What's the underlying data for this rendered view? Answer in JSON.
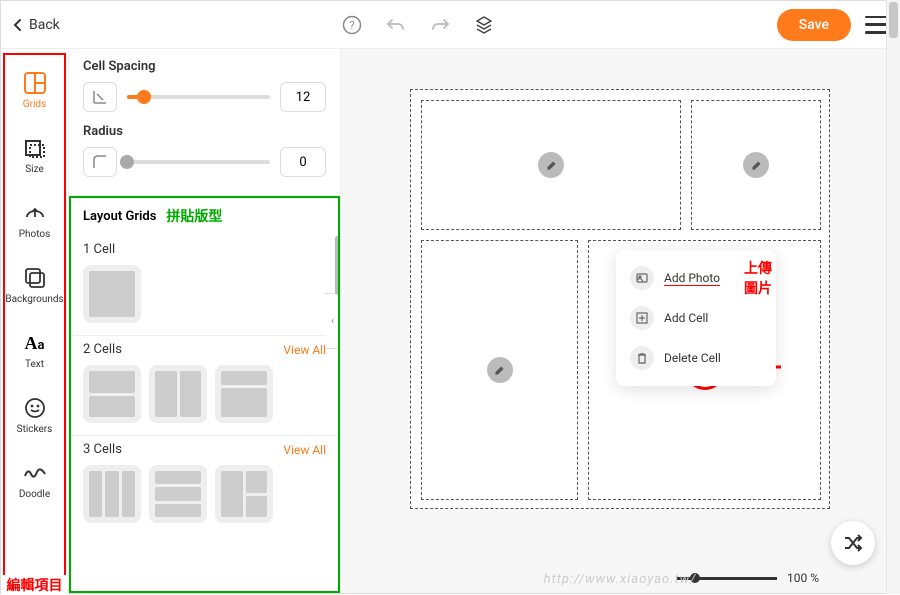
{
  "topbar": {
    "back": "Back",
    "save": "Save"
  },
  "sidebar": {
    "items": [
      {
        "label": "Grids"
      },
      {
        "label": "Size"
      },
      {
        "label": "Photos"
      },
      {
        "label": "Backgrounds"
      },
      {
        "label": "Text"
      },
      {
        "label": "Stickers"
      },
      {
        "label": "Doodle"
      }
    ],
    "annotation": "編輯項目"
  },
  "panel": {
    "cellSpacing": {
      "label": "Cell Spacing",
      "value": "12"
    },
    "radius": {
      "label": "Radius",
      "value": "0"
    },
    "layoutTitle": "Layout Grids",
    "layoutAnnotation": "拼貼版型",
    "sections": [
      {
        "title": "1 Cell"
      },
      {
        "title": "2 Cells",
        "viewAll": "View All"
      },
      {
        "title": "3 Cells",
        "viewAll": "View All"
      }
    ]
  },
  "contextMenu": {
    "addPhoto": "Add Photo",
    "addCell": "Add Cell",
    "deleteCell": "Delete Cell",
    "annotation": "上傳圖片"
  },
  "zoom": {
    "value": "100 %"
  },
  "watermark": "http://www.xiaoyao.tw/"
}
